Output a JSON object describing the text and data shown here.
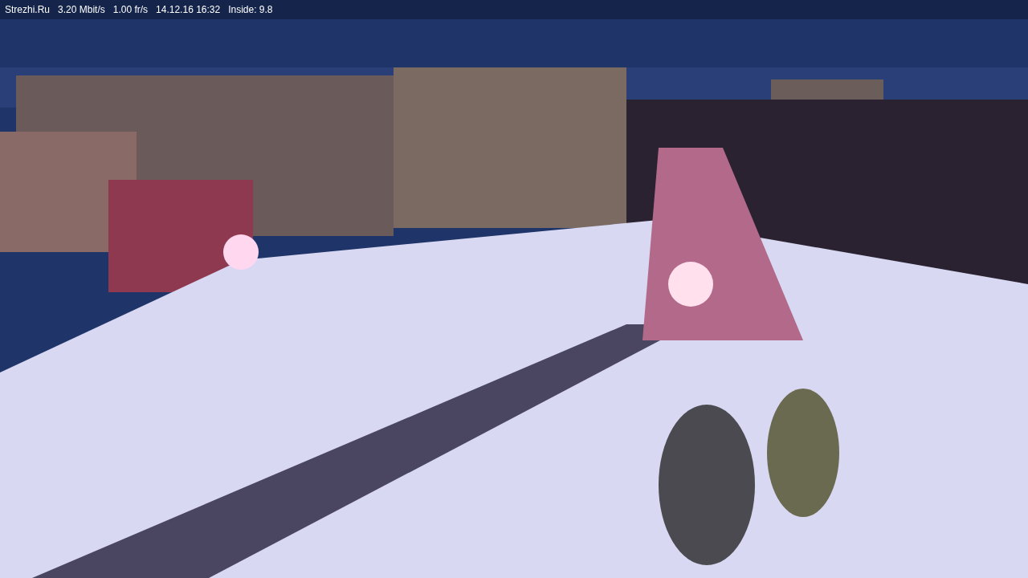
{
  "status_bar": {
    "items": [
      "Strezhi.Ru",
      "3.20 Mbit/s",
      "1.00 fr/s",
      "14.12.16 16:32",
      "Inside: 9.8"
    ]
  }
}
